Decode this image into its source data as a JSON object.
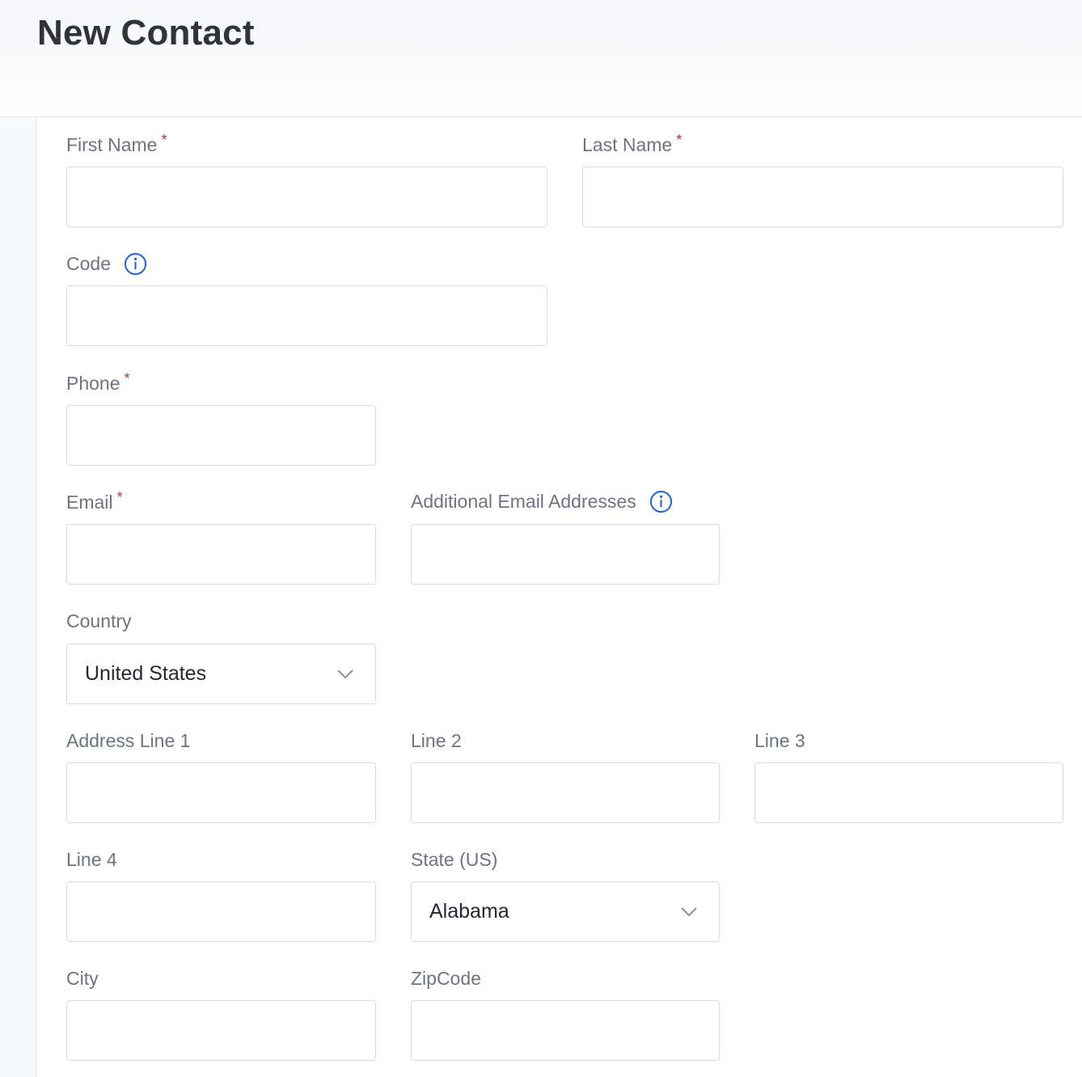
{
  "page": {
    "title": "New Contact"
  },
  "form": {
    "first_name": {
      "label": "First Name",
      "required_mark": "*",
      "value": ""
    },
    "last_name": {
      "label": "Last Name",
      "required_mark": "*",
      "value": ""
    },
    "code": {
      "label": "Code",
      "value": "",
      "icon": "info-icon"
    },
    "phone": {
      "label": "Phone",
      "required_mark": "*",
      "value": ""
    },
    "email": {
      "label": "Email",
      "required_mark": "*",
      "value": ""
    },
    "additional_emails": {
      "label": "Additional Email Addresses",
      "value": "",
      "icon": "info-icon"
    },
    "country": {
      "label": "Country",
      "selected": "United States",
      "icon": "chevron-down-icon"
    },
    "address_line_1": {
      "label": "Address Line 1",
      "value": ""
    },
    "line_2": {
      "label": "Line 2",
      "value": ""
    },
    "line_3": {
      "label": "Line 3",
      "value": ""
    },
    "line_4": {
      "label": "Line 4",
      "value": ""
    },
    "state": {
      "label": "State (US)",
      "selected": "Alabama",
      "icon": "chevron-down-icon"
    },
    "city": {
      "label": "City",
      "value": ""
    },
    "zipcode": {
      "label": "ZipCode",
      "value": ""
    }
  },
  "colors": {
    "label": "#6d7380",
    "required": "#b1342f",
    "info_accent": "#2a66d9",
    "border": "#d8dbe0",
    "title": "#2f333c"
  }
}
